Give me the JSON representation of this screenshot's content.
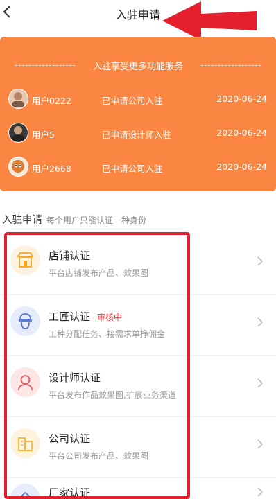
{
  "header": {
    "title": "入驻申请"
  },
  "banner": {
    "title": "入驻享受更多功能服务",
    "records": [
      {
        "user": "用户0222",
        "action": "已申请公司入驻",
        "date": "2020-06-24"
      },
      {
        "user": "用户5",
        "action": "已申请设计师入驻",
        "date": "2020-06-24"
      },
      {
        "user": "用户2668",
        "action": "已申请公司入驻",
        "date": "2020-06-24"
      }
    ]
  },
  "section": {
    "title": "入驻申请",
    "subtitle": "每个用户只能认证一种身份"
  },
  "items": [
    {
      "title": "店铺认证",
      "desc": "平台店铺发布产品、效果图",
      "badge": "",
      "icon": "store-icon",
      "color": "#f5a623"
    },
    {
      "title": "工匠认证",
      "desc": "工种分配任务、接需求单挣佣金",
      "badge": "审核中",
      "icon": "worker-helmet-icon",
      "color": "#5b7bd5"
    },
    {
      "title": "设计师认证",
      "desc": "平台发布作品效果图,扩展业务渠道",
      "badge": "",
      "icon": "designer-icon",
      "color": "#e25a5a"
    },
    {
      "title": "公司认证",
      "desc": "平台公司发布产品、效果图",
      "badge": "",
      "icon": "building-icon",
      "color": "#f2b53a"
    },
    {
      "title": "厂家认证",
      "desc": "",
      "badge": "",
      "icon": "factory-icon",
      "color": "#5b7bd5"
    }
  ],
  "colors": {
    "banner": "#fa8642",
    "annotation": "#e3202b",
    "badge": "#e03a3a"
  }
}
